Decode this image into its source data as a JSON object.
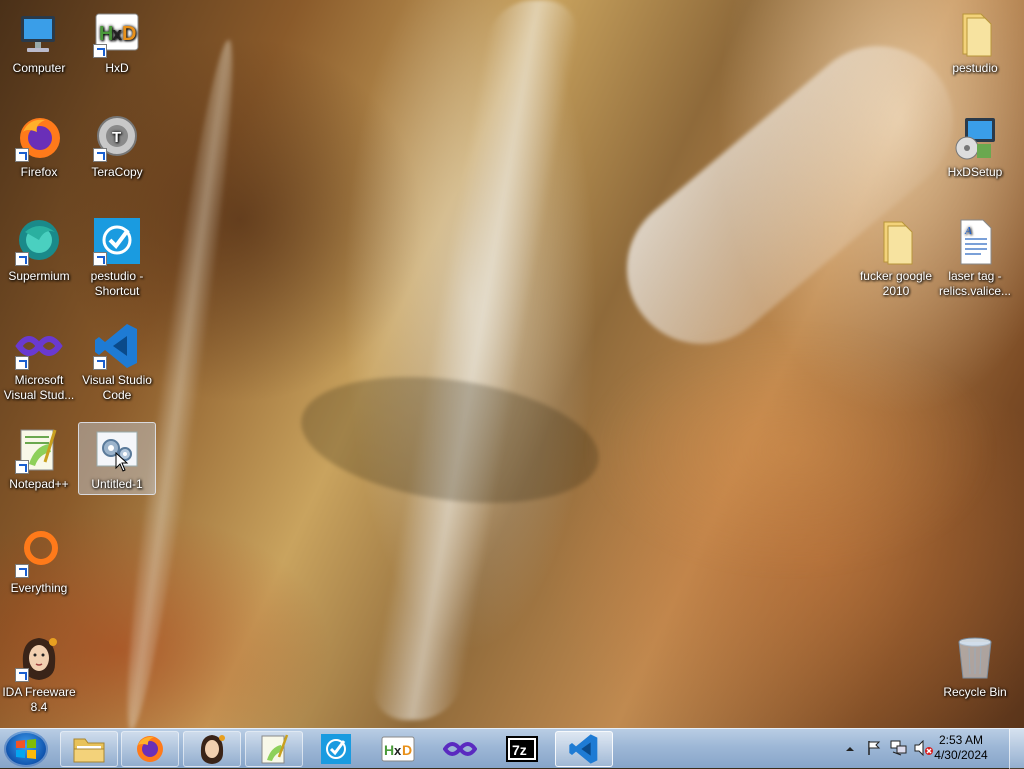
{
  "desktop": {
    "icons": [
      {
        "label": "Computer",
        "icon": "computer-icon"
      },
      {
        "label": "HxD",
        "icon": "hxd-icon"
      },
      {
        "label": "pestudio",
        "icon": "folder-icon"
      },
      {
        "label": "Firefox",
        "icon": "firefox-icon"
      },
      {
        "label": "TeraCopy",
        "icon": "teracopy-icon"
      },
      {
        "label": "HxDSetup",
        "icon": "installer-icon"
      },
      {
        "label": "Supermium",
        "icon": "supermium-icon"
      },
      {
        "label": "pestudio - Shortcut",
        "icon": "pestudio-icon"
      },
      {
        "label": "fucker google 2010",
        "icon": "folder-icon"
      },
      {
        "label": "laser tag - relics.valice...",
        "icon": "document-icon"
      },
      {
        "label": "Microsoft Visual Stud...",
        "icon": "visual-studio-icon"
      },
      {
        "label": "Visual Studio Code",
        "icon": "vscode-icon"
      },
      {
        "label": "Notepad++",
        "icon": "notepadpp-icon"
      },
      {
        "label": "Untitled-1",
        "icon": "settings-file-icon"
      },
      {
        "label": "Everything",
        "icon": "everything-icon"
      },
      {
        "label": "IDA Freeware 8.4",
        "icon": "ida-icon"
      },
      {
        "label": "Recycle Bin",
        "icon": "recycle-bin-icon"
      }
    ]
  },
  "taskbar": {
    "start_icon": "windows-start-icon",
    "pinned": [
      {
        "name": "explorer",
        "icon": "folder-icon"
      },
      {
        "name": "firefox",
        "icon": "firefox-icon"
      },
      {
        "name": "ida",
        "icon": "ida-icon"
      },
      {
        "name": "notepadpp",
        "icon": "notepadpp-icon"
      },
      {
        "name": "pestudio",
        "icon": "pestudio-icon"
      },
      {
        "name": "hxd",
        "icon": "hxd-icon"
      },
      {
        "name": "visual-studio",
        "icon": "visual-studio-icon"
      },
      {
        "name": "7zip",
        "icon": "7zip-icon"
      },
      {
        "name": "vscode",
        "icon": "vscode-icon"
      }
    ],
    "clock": {
      "time": "2:53 AM",
      "date": "4/30/2024"
    }
  },
  "colors": {
    "taskbar": "#9db7d6",
    "vscode_blue": "#1e7bd4",
    "firefox_orange": "#ff7a1a",
    "selection": "#c8d2e1"
  }
}
